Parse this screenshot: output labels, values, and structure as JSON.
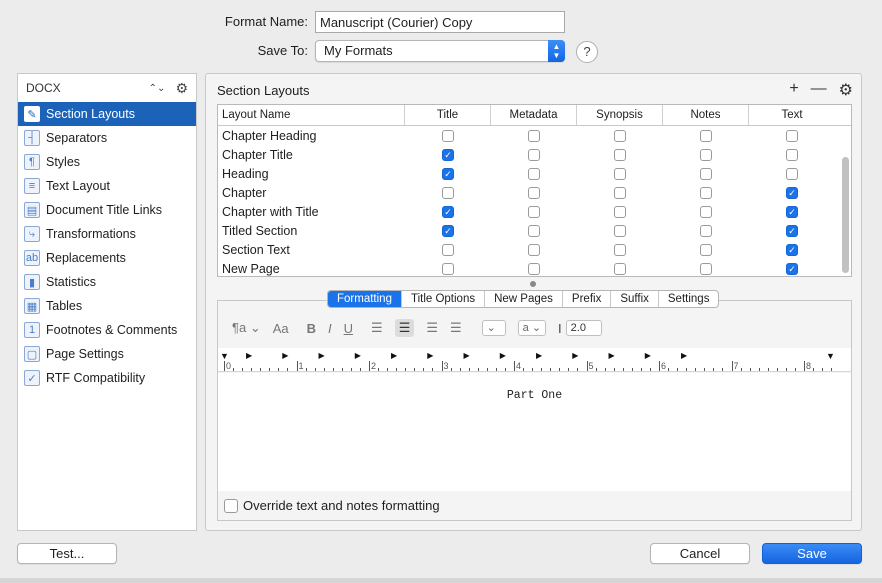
{
  "form": {
    "format_name_label": "Format Name:",
    "format_name_value": "Manuscript (Courier) Copy",
    "save_to_label": "Save To:",
    "save_to_value": "My Formats",
    "help_label": "?"
  },
  "sidebar": {
    "selector": "DOCX",
    "items": [
      {
        "label": "Section Layouts",
        "icon": "brush-icon",
        "glyph": "✎"
      },
      {
        "label": "Separators",
        "icon": "separator-icon",
        "glyph": "┤"
      },
      {
        "label": "Styles",
        "icon": "styles-icon",
        "glyph": "¶"
      },
      {
        "label": "Text Layout",
        "icon": "text-layout-icon",
        "glyph": "≡"
      },
      {
        "label": "Document Title Links",
        "icon": "title-links-icon",
        "glyph": "▤"
      },
      {
        "label": "Transformations",
        "icon": "transformations-icon",
        "glyph": "⤷"
      },
      {
        "label": "Replacements",
        "icon": "replacements-icon",
        "glyph": "ab"
      },
      {
        "label": "Statistics",
        "icon": "statistics-icon",
        "glyph": "▮"
      },
      {
        "label": "Tables",
        "icon": "tables-icon",
        "glyph": "▦"
      },
      {
        "label": "Footnotes & Comments",
        "icon": "footnotes-icon",
        "glyph": "1"
      },
      {
        "label": "Page Settings",
        "icon": "page-settings-icon",
        "glyph": "▢"
      },
      {
        "label": "RTF Compatibility",
        "icon": "rtf-compat-icon",
        "glyph": "✓"
      }
    ]
  },
  "main": {
    "title": "Section Layouts",
    "columns": [
      "Layout Name",
      "Title",
      "Metadata",
      "Synopsis",
      "Notes",
      "Text"
    ],
    "rows": [
      {
        "name": "Chapter Heading",
        "checks": [
          false,
          false,
          false,
          false,
          false
        ]
      },
      {
        "name": "Chapter Title",
        "checks": [
          true,
          false,
          false,
          false,
          false
        ]
      },
      {
        "name": "Heading",
        "checks": [
          true,
          false,
          false,
          false,
          false
        ]
      },
      {
        "name": "Chapter",
        "checks": [
          false,
          false,
          false,
          false,
          true
        ]
      },
      {
        "name": "Chapter with Title",
        "checks": [
          true,
          false,
          false,
          false,
          true
        ]
      },
      {
        "name": "Titled Section",
        "checks": [
          true,
          false,
          false,
          false,
          true
        ]
      },
      {
        "name": "Section Text",
        "checks": [
          false,
          false,
          false,
          false,
          true
        ]
      },
      {
        "name": "New Page",
        "checks": [
          false,
          false,
          false,
          false,
          true
        ]
      }
    ],
    "tabs": [
      "Formatting",
      "Title Options",
      "New Pages",
      "Prefix",
      "Suffix",
      "Settings"
    ],
    "toolbar": {
      "paragraph": "¶a ⌄",
      "font": "Aa",
      "bold": "B",
      "italic": "I",
      "underline": "U",
      "char_style": "a ⌄",
      "line_spacing": "2.0"
    },
    "ruler_numbers": [
      "0",
      "1",
      "2",
      "3",
      "4",
      "5",
      "6",
      "7",
      "8"
    ],
    "preview_text": "Part One",
    "override_label": "Override text and notes formatting"
  },
  "buttons": {
    "test": "Test...",
    "cancel": "Cancel",
    "save": "Save"
  },
  "colors": {
    "accent": "#1a73e8",
    "sidebar_active": "#1d62b9"
  }
}
